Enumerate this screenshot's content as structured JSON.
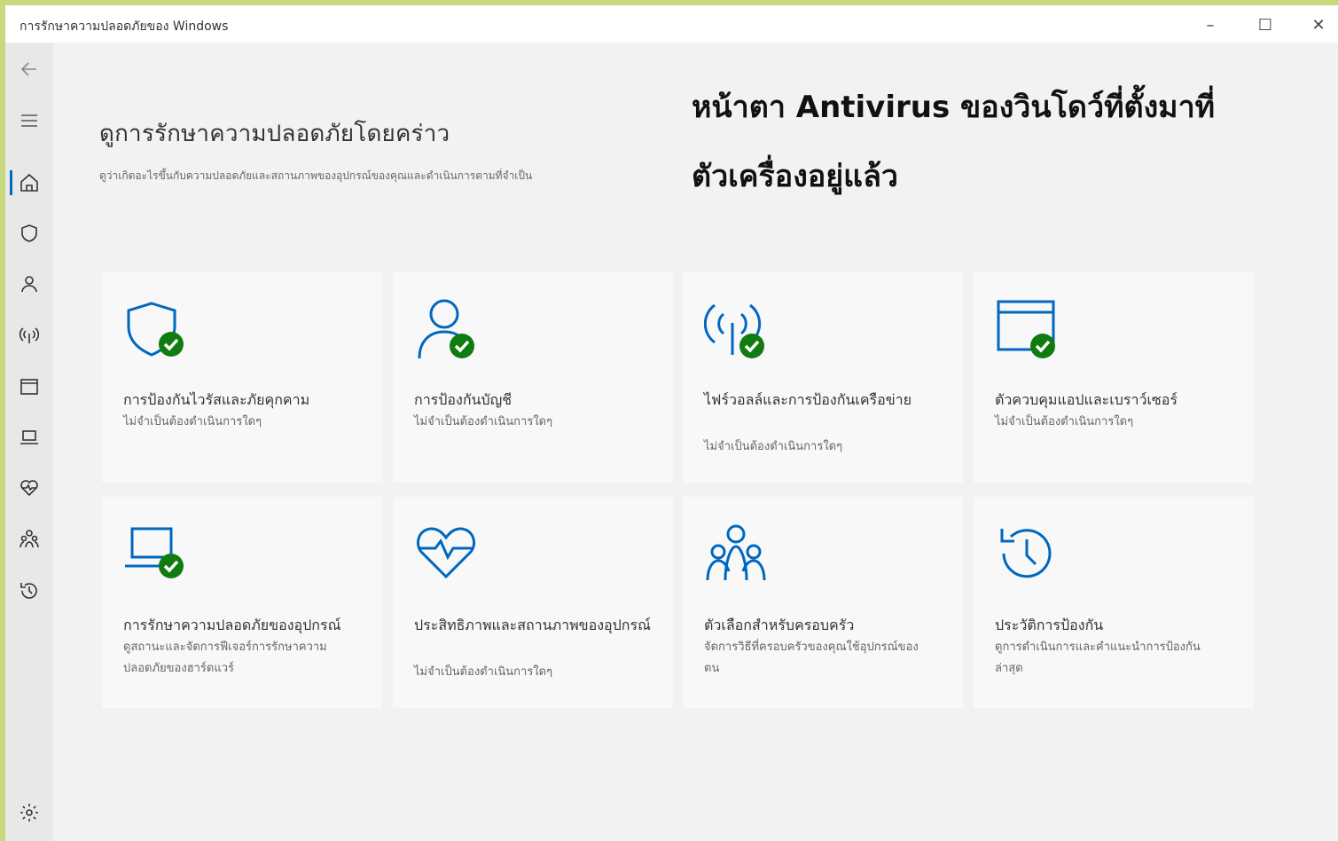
{
  "window": {
    "title": "การรักษาความปลอดภัยของ Windows",
    "minimize_label": "–",
    "maximize_label": "☐",
    "close_label": "✕"
  },
  "sidebar": {
    "items": [
      {
        "name": "back",
        "icon": "back-arrow-icon"
      },
      {
        "name": "menu",
        "icon": "hamburger-icon"
      },
      {
        "name": "home",
        "icon": "home-icon",
        "active": true
      },
      {
        "name": "virus-protection",
        "icon": "shield-icon"
      },
      {
        "name": "account-protection",
        "icon": "person-icon"
      },
      {
        "name": "firewall",
        "icon": "antenna-icon"
      },
      {
        "name": "app-browser-control",
        "icon": "browser-window-icon"
      },
      {
        "name": "device-security",
        "icon": "laptop-icon"
      },
      {
        "name": "device-performance",
        "icon": "heart-pulse-icon"
      },
      {
        "name": "family-options",
        "icon": "family-icon"
      },
      {
        "name": "protection-history",
        "icon": "history-icon"
      },
      {
        "name": "settings",
        "icon": "gear-icon"
      }
    ]
  },
  "main": {
    "title": "ดูการรักษาความปลอดภัยโดยคร่าว",
    "subtitle": "ดูว่าเกิดอะไรขึ้นกับความปลอดภัยและสถานภาพของอุปกรณ์ของคุณและดำเนินการตามที่จำเป็น"
  },
  "overlay": {
    "line1": "หน้าตา Antivirus ของวินโดว์ที่ตั้งมาที่",
    "line2": "ตัวเครื่องอยู่แล้ว"
  },
  "tiles": [
    {
      "icon": "shield-check-icon",
      "name": "การป้องกันไวรัสและภัยคุกคาม",
      "status": "ไม่จำเป็นต้องดำเนินการใดๆ",
      "ok": true
    },
    {
      "icon": "person-check-icon",
      "name": "การป้องกันบัญชี",
      "status": "ไม่จำเป็นต้องดำเนินการใดๆ",
      "ok": true
    },
    {
      "icon": "antenna-check-icon",
      "name": "ไฟร์วอลล์และการป้องกันเครือข่าย",
      "status": "ไม่จำเป็นต้องดำเนินการใดๆ",
      "ok": true
    },
    {
      "icon": "browser-check-icon",
      "name": "ตัวควบคุมแอปและเบราว์เซอร์",
      "status": "ไม่จำเป็นต้องดำเนินการใดๆ",
      "ok": true
    },
    {
      "icon": "laptop-check-icon",
      "name": "การรักษาความปลอดภัยของอุปกรณ์",
      "status": "ดูสถานะและจัดการฟีเจอร์การรักษาความปลอดภัยของฮาร์ดแวร์",
      "ok": true
    },
    {
      "icon": "heart-pulse-icon",
      "name": "ประสิทธิภาพและสถานภาพของอุปกรณ์",
      "status": "ไม่จำเป็นต้องดำเนินการใดๆ",
      "ok": false
    },
    {
      "icon": "family-icon",
      "name": "ตัวเลือกสำหรับครอบครัว",
      "status": "จัดการวิธีที่ครอบครัวของคุณใช้อุปกรณ์ของตน",
      "ok": false
    },
    {
      "icon": "history-icon",
      "name": "ประวัติการป้องกัน",
      "status": "ดูการดำเนินการและคำแนะนำการป้องกันล่าสุด",
      "ok": false
    }
  ],
  "colors": {
    "accent": "#0067c0",
    "ok_badge": "#107c10",
    "main_bg": "#f2f2f2",
    "tile_bg": "#f8f8f8"
  }
}
